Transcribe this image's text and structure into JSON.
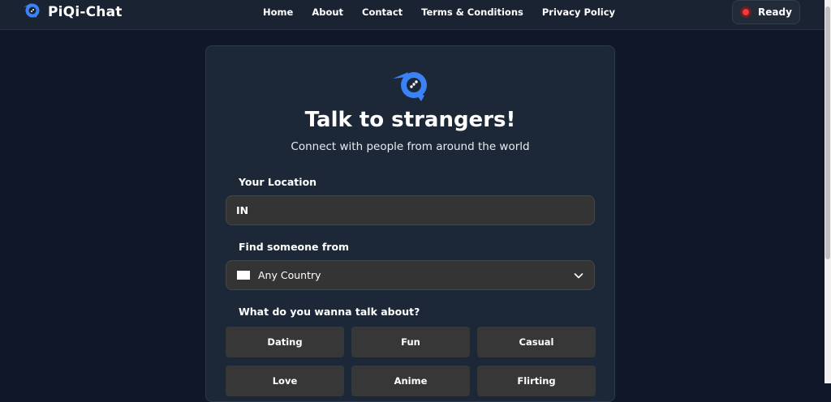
{
  "nav": {
    "brand": "PiQi-Chat",
    "links": [
      "Home",
      "About",
      "Contact",
      "Terms & Conditions",
      "Privacy Policy"
    ],
    "status": "Ready"
  },
  "card": {
    "title": "Talk to strangers!",
    "subtitle": "Connect with people from around the world"
  },
  "location": {
    "label": "Your Location",
    "value": "IN"
  },
  "country": {
    "label": "Find someone from",
    "selected": "Any Country"
  },
  "topics": {
    "label": "What do you wanna talk about?",
    "items": [
      "Dating",
      "Fun",
      "Casual",
      "Love",
      "Anime",
      "Flirting"
    ]
  },
  "colors": {
    "accent": "#3b82f6",
    "status_dot": "#ef3b3b",
    "background": "#0f1729",
    "card": "#1c2838"
  },
  "icons": [
    "piqi-logo-icon",
    "recording-dot-icon",
    "flag-placeholder-icon",
    "chevron-down-icon"
  ]
}
